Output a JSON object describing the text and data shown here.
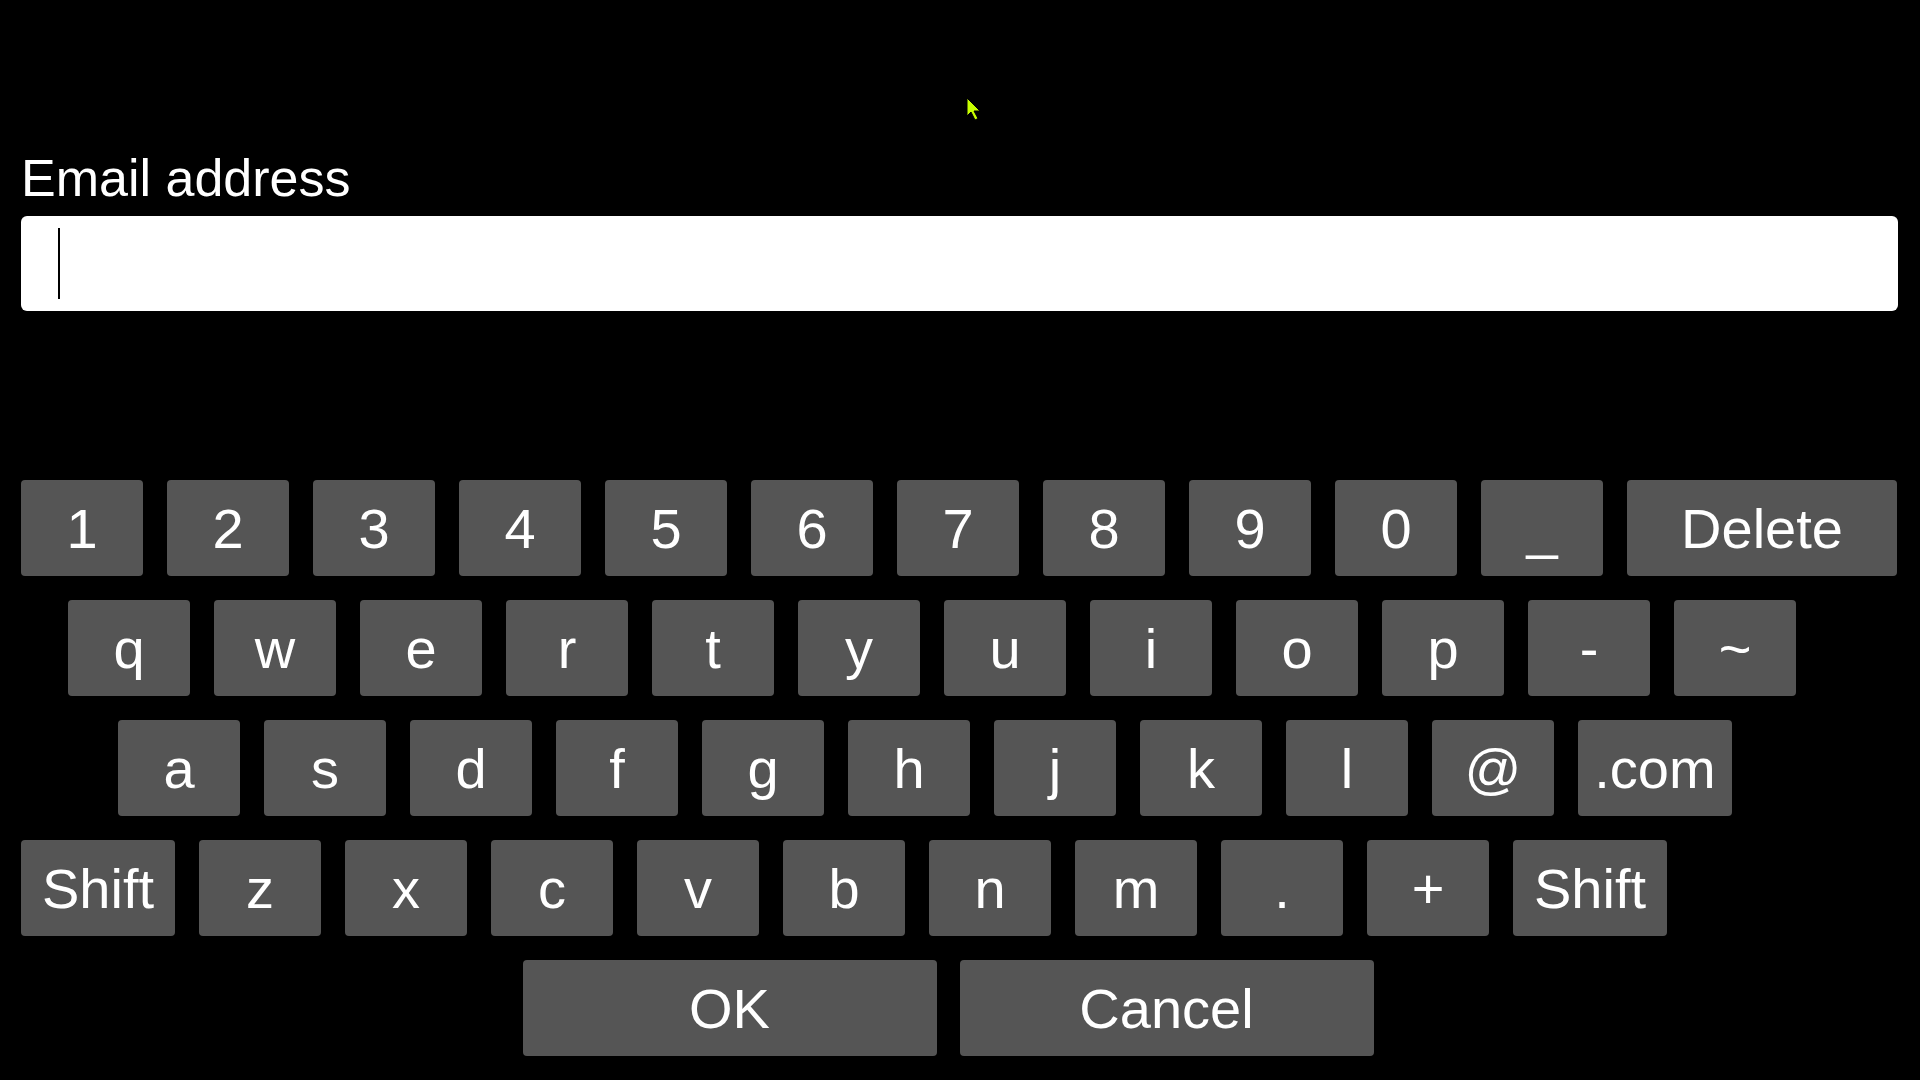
{
  "label": "Email address",
  "field": {
    "focused": true
  },
  "keyboard": {
    "rows": [
      [
        {
          "label": "1",
          "kind": "char"
        },
        {
          "label": "2",
          "kind": "char"
        },
        {
          "label": "3",
          "kind": "char"
        },
        {
          "label": "4",
          "kind": "char"
        },
        {
          "label": "5",
          "kind": "char"
        },
        {
          "label": "6",
          "kind": "char"
        },
        {
          "label": "7",
          "kind": "char"
        },
        {
          "label": "8",
          "kind": "char"
        },
        {
          "label": "9",
          "kind": "char"
        },
        {
          "label": "0",
          "kind": "char"
        },
        {
          "label": "_",
          "kind": "char"
        },
        {
          "label": "Delete",
          "kind": "wide"
        }
      ],
      [
        {
          "label": "q",
          "kind": "char"
        },
        {
          "label": "w",
          "kind": "char"
        },
        {
          "label": "e",
          "kind": "char"
        },
        {
          "label": "r",
          "kind": "char"
        },
        {
          "label": "t",
          "kind": "char"
        },
        {
          "label": "y",
          "kind": "char"
        },
        {
          "label": "u",
          "kind": "char"
        },
        {
          "label": "i",
          "kind": "char"
        },
        {
          "label": "o",
          "kind": "char"
        },
        {
          "label": "p",
          "kind": "char"
        },
        {
          "label": "-",
          "kind": "char"
        },
        {
          "label": "~",
          "kind": "char"
        }
      ],
      [
        {
          "label": "a",
          "kind": "char"
        },
        {
          "label": "s",
          "kind": "char"
        },
        {
          "label": "d",
          "kind": "char"
        },
        {
          "label": "f",
          "kind": "char"
        },
        {
          "label": "g",
          "kind": "char"
        },
        {
          "label": "h",
          "kind": "char"
        },
        {
          "label": "j",
          "kind": "char"
        },
        {
          "label": "k",
          "kind": "char"
        },
        {
          "label": "l",
          "kind": "char"
        },
        {
          "label": "@",
          "kind": "char"
        },
        {
          "label": ".com",
          "kind": "medium"
        }
      ],
      [
        {
          "label": "Shift",
          "kind": "medium"
        },
        {
          "label": "z",
          "kind": "char"
        },
        {
          "label": "x",
          "kind": "char"
        },
        {
          "label": "c",
          "kind": "char"
        },
        {
          "label": "v",
          "kind": "char"
        },
        {
          "label": "b",
          "kind": "char"
        },
        {
          "label": "n",
          "kind": "char"
        },
        {
          "label": "m",
          "kind": "char"
        },
        {
          "label": ".",
          "kind": "char"
        },
        {
          "label": "+",
          "kind": "char"
        },
        {
          "label": "Shift",
          "kind": "medium"
        }
      ]
    ],
    "actions": [
      {
        "label": "OK"
      },
      {
        "label": "Cancel"
      }
    ]
  }
}
